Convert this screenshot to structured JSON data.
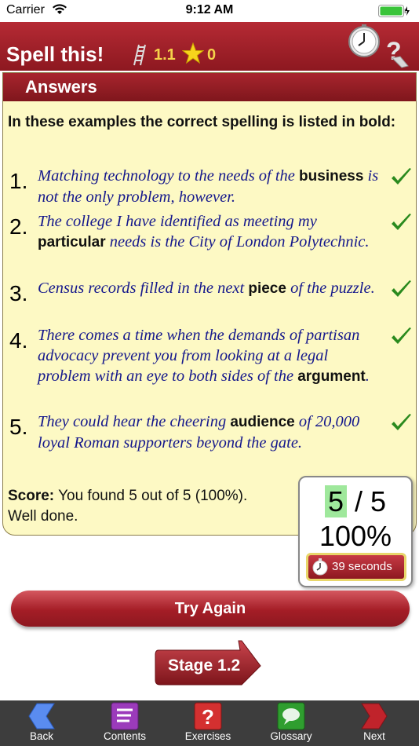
{
  "status": {
    "carrier": "Carrier",
    "time": "9:12 AM"
  },
  "header": {
    "title": "Spell this!",
    "level": "1.1",
    "stars": "0"
  },
  "answers": {
    "heading": "Answers",
    "intro": "In these examples the correct spelling is listed in bold:",
    "items": [
      {
        "num": "1.",
        "pre": "Matching technology to the needs of the ",
        "word": "business",
        "post": " is not the only problem, however."
      },
      {
        "num": "2.",
        "pre": "The college I have identified as meeting my ",
        "word": "particular",
        "post": " needs is the City of London Polytechnic."
      },
      {
        "num": "3.",
        "pre": "Census records filled in the next ",
        "word": "piece",
        "post": " of the puzzle."
      },
      {
        "num": "4.",
        "pre": "There comes a time when the demands of partisan advocacy prevent you from looking at a legal problem with an eye to both sides of the ",
        "word": "argument",
        "post": "."
      },
      {
        "num": "5.",
        "pre": "They could hear the cheering ",
        "word": "audience",
        "post": " of 20,000 loyal Roman supporters beyond the gate."
      }
    ],
    "score_label": "Score:",
    "score_text": " You found 5 out of 5 (100%).",
    "score_comment": "Well done."
  },
  "scorebox": {
    "correct": "5",
    "separator": " / ",
    "total": "5",
    "percent": "100%",
    "time": "39 seconds"
  },
  "buttons": {
    "try_again": "Try Again",
    "next_stage": "Stage 1.2"
  },
  "tabbar": {
    "items": [
      {
        "label": "Back",
        "icon": "back-arrow-icon",
        "color": "#4a7fe0"
      },
      {
        "label": "Contents",
        "icon": "contents-icon",
        "color": "#8a2fa8"
      },
      {
        "label": "Exercises",
        "icon": "exercises-icon",
        "color": "#c62a2a"
      },
      {
        "label": "Glossary",
        "icon": "glossary-icon",
        "color": "#2e9a2e"
      },
      {
        "label": "Next",
        "icon": "next-arrow-icon",
        "color": "#b81e24"
      }
    ]
  },
  "colors": {
    "header": "#9e1f28",
    "panel": "#fdf9c4",
    "italic_text": "#15188c",
    "accent_yellow": "#f5d24a"
  }
}
